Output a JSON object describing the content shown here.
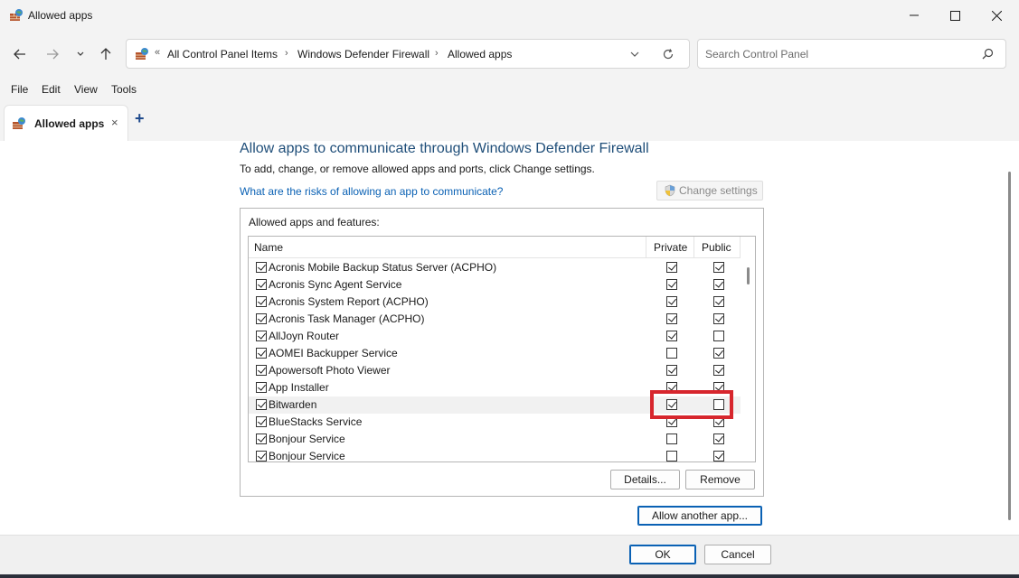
{
  "window": {
    "title": "Allowed apps"
  },
  "nav": {
    "back": "back",
    "forward": "forward",
    "recent": "recent",
    "up": "up"
  },
  "address": {
    "overflow": "«",
    "crumbs": [
      "All Control Panel Items",
      "Windows Defender Firewall",
      "Allowed apps"
    ],
    "separator": "›"
  },
  "search": {
    "placeholder": "Search Control Panel"
  },
  "menu": {
    "file": "File",
    "edit": "Edit",
    "view": "View",
    "tools": "Tools"
  },
  "tabs": {
    "active_label": "Allowed apps",
    "close": "×",
    "new": "+"
  },
  "main": {
    "heading": "Allow apps to communicate through Windows Defender Firewall",
    "subtext": "To add, change, or remove allowed apps and ports, click Change settings.",
    "risk_link": "What are the risks of allowing an app to communicate?",
    "change_settings": "Change settings",
    "group_title": "Allowed apps and features:",
    "columns": {
      "name": "Name",
      "private": "Private",
      "public": "Public"
    },
    "rows": [
      {
        "name": "Acronis Mobile Backup Status Server (ACPHO)",
        "enabled": true,
        "private": true,
        "public": true
      },
      {
        "name": "Acronis Sync Agent Service",
        "enabled": true,
        "private": true,
        "public": true
      },
      {
        "name": "Acronis System Report (ACPHO)",
        "enabled": true,
        "private": true,
        "public": true
      },
      {
        "name": "Acronis Task Manager (ACPHO)",
        "enabled": true,
        "private": true,
        "public": true
      },
      {
        "name": "AllJoyn Router",
        "enabled": true,
        "private": true,
        "public": false
      },
      {
        "name": "AOMEI Backupper Service",
        "enabled": true,
        "private": false,
        "public": true
      },
      {
        "name": "Apowersoft Photo Viewer",
        "enabled": true,
        "private": true,
        "public": true
      },
      {
        "name": "App Installer",
        "enabled": true,
        "private": true,
        "public": true
      },
      {
        "name": "Bitwarden",
        "enabled": true,
        "private": true,
        "public": false,
        "highlighted": true
      },
      {
        "name": "BlueStacks Service",
        "enabled": true,
        "private": true,
        "public": true
      },
      {
        "name": "Bonjour Service",
        "enabled": true,
        "private": false,
        "public": true
      },
      {
        "name": "Bonjour Service",
        "enabled": true,
        "private": false,
        "public": true
      }
    ],
    "details_button": "Details...",
    "remove_button": "Remove",
    "allow_another_button": "Allow another app..."
  },
  "footer": {
    "ok": "OK",
    "cancel": "Cancel"
  },
  "colors": {
    "heading": "#1f4e79",
    "link": "#0a61b4",
    "highlight_box": "#d7262d",
    "chrome": "#f3f3f3"
  }
}
